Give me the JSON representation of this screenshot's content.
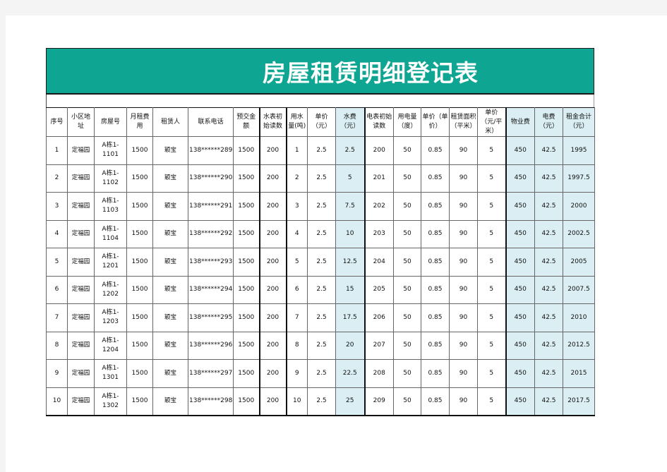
{
  "title": "房屋租赁明细登记表",
  "colors": {
    "title_bg": "#0ea593",
    "highlight": "#daeef3"
  },
  "headers": [
    {
      "label": "序号"
    },
    {
      "label": "小区地址"
    },
    {
      "label": "房屋号"
    },
    {
      "label": "月租费用"
    },
    {
      "label": "租赁人"
    },
    {
      "label": "联系电话"
    },
    {
      "label": "预交金额"
    },
    {
      "label": "水表初始读数"
    },
    {
      "label": "用水量(吨)"
    },
    {
      "label": "单价（元）"
    },
    {
      "label": "水费（元）"
    },
    {
      "label": "电表初始读数"
    },
    {
      "label": "用电量（度）"
    },
    {
      "label": "单价（单价）"
    },
    {
      "label": "租赁面积（平米）"
    },
    {
      "label": "单价（元/平米）"
    },
    {
      "label": "物业费"
    },
    {
      "label": "电费（元）"
    },
    {
      "label": "租金合计（元）"
    }
  ],
  "rows": [
    [
      "1",
      "定福园",
      "A栋1-1101",
      "1500",
      "颖宝",
      "138******289",
      "1500",
      "200",
      "1",
      "2.5",
      "2.5",
      "200",
      "50",
      "0.85",
      "90",
      "5",
      "450",
      "42.5",
      "1995"
    ],
    [
      "2",
      "定福园",
      "A栋1-1102",
      "1500",
      "颖宝",
      "138******290",
      "1500",
      "200",
      "2",
      "2.5",
      "5",
      "201",
      "50",
      "0.85",
      "90",
      "5",
      "450",
      "42.5",
      "1997.5"
    ],
    [
      "3",
      "定福园",
      "A栋1-1103",
      "1500",
      "颖宝",
      "138******291",
      "1500",
      "200",
      "3",
      "2.5",
      "7.5",
      "202",
      "50",
      "0.85",
      "90",
      "5",
      "450",
      "42.5",
      "2000"
    ],
    [
      "4",
      "定福园",
      "A栋1-1104",
      "1500",
      "颖宝",
      "138******292",
      "1500",
      "200",
      "4",
      "2.5",
      "10",
      "203",
      "50",
      "0.85",
      "90",
      "5",
      "450",
      "42.5",
      "2002.5"
    ],
    [
      "5",
      "定福园",
      "A栋1-1201",
      "1500",
      "颖宝",
      "138******293",
      "1500",
      "200",
      "5",
      "2.5",
      "12.5",
      "204",
      "50",
      "0.85",
      "90",
      "5",
      "450",
      "42.5",
      "2005"
    ],
    [
      "6",
      "定福园",
      "A栋1-1202",
      "1500",
      "颖宝",
      "138******294",
      "1500",
      "200",
      "6",
      "2.5",
      "15",
      "205",
      "50",
      "0.85",
      "90",
      "5",
      "450",
      "42.5",
      "2007.5"
    ],
    [
      "7",
      "定福园",
      "A栋1-1203",
      "1500",
      "颖宝",
      "138******295",
      "1500",
      "200",
      "7",
      "2.5",
      "17.5",
      "206",
      "50",
      "0.85",
      "90",
      "5",
      "450",
      "42.5",
      "2010"
    ],
    [
      "8",
      "定福园",
      "A栋1-1204",
      "1500",
      "颖宝",
      "138******296",
      "1500",
      "200",
      "8",
      "2.5",
      "20",
      "207",
      "50",
      "0.85",
      "90",
      "5",
      "450",
      "42.5",
      "2012.5"
    ],
    [
      "9",
      "定福园",
      "A栋1-1301",
      "1500",
      "颖宝",
      "138******297",
      "1500",
      "200",
      "9",
      "2.5",
      "22.5",
      "208",
      "50",
      "0.85",
      "90",
      "5",
      "450",
      "42.5",
      "2015"
    ],
    [
      "10",
      "定福园",
      "A栋1-1302",
      "1500",
      "颖宝",
      "138******298",
      "1500",
      "200",
      "10",
      "2.5",
      "25",
      "209",
      "50",
      "0.85",
      "90",
      "5",
      "450",
      "42.5",
      "2017.5"
    ]
  ]
}
